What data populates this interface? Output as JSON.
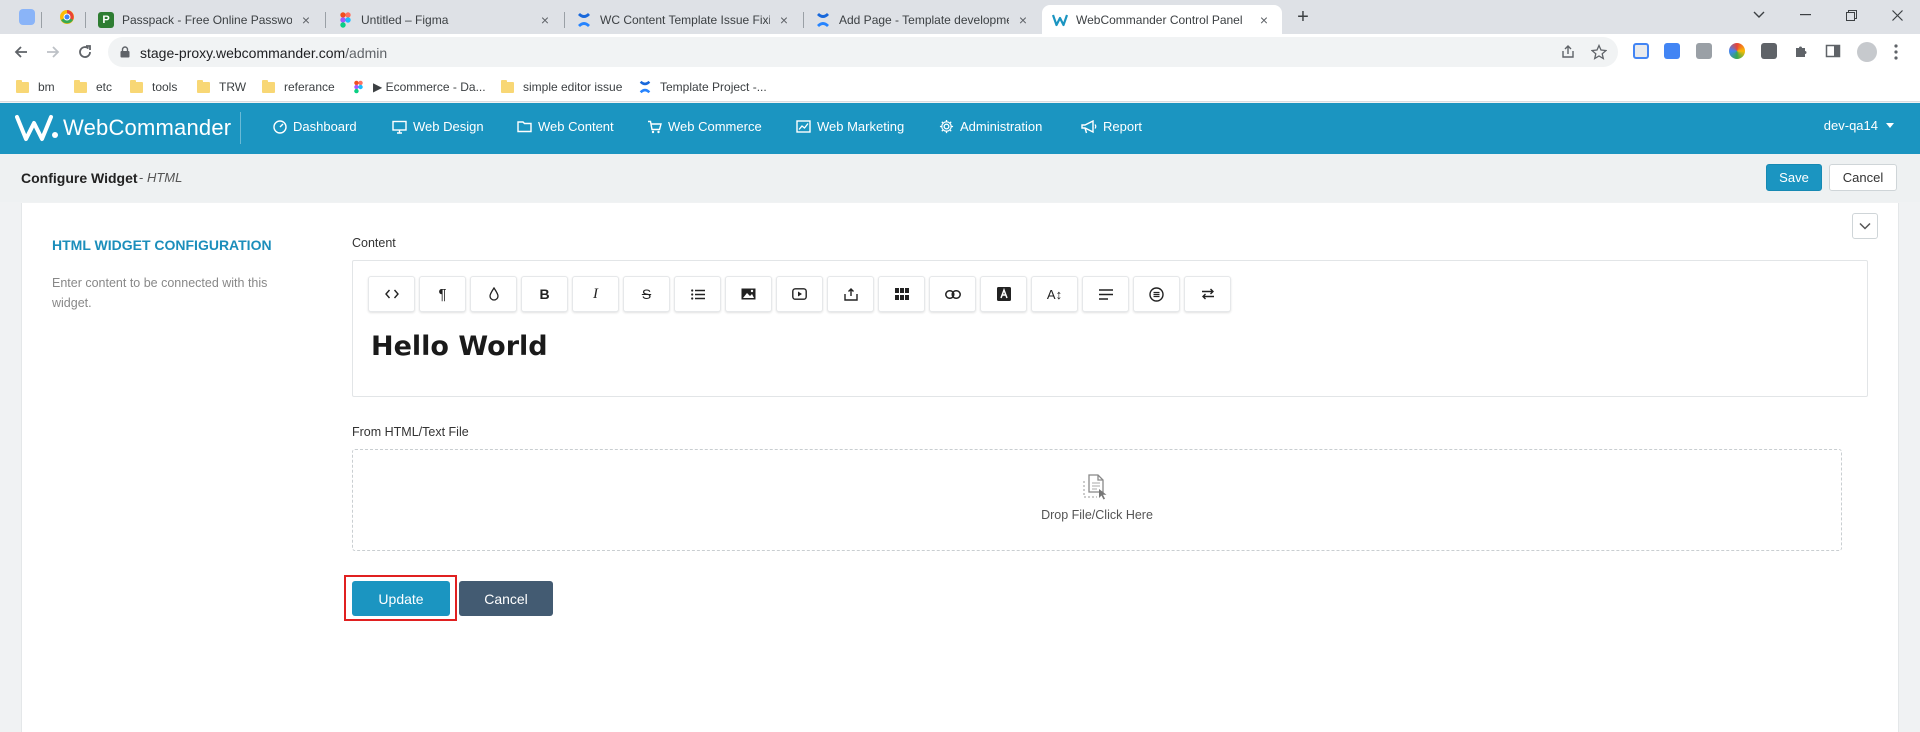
{
  "browser": {
    "tabs": [
      {
        "title": "Passpack - Free Online Password",
        "favicon": "passpack-icon"
      },
      {
        "title": "Untitled – Figma",
        "favicon": "figma-icon"
      },
      {
        "title": "WC Content Template Issue Fixing",
        "favicon": "confluence-icon"
      },
      {
        "title": "Add Page - Template development",
        "favicon": "confluence-icon"
      },
      {
        "title": "WebCommander Control Panel",
        "favicon": "webcommander-icon",
        "active": true
      }
    ],
    "url_host": "stage-proxy.webcommander.com",
    "url_path": "/admin",
    "bookmarks": [
      {
        "label": "bm",
        "icon": "folder-icon"
      },
      {
        "label": "etc",
        "icon": "folder-icon"
      },
      {
        "label": "tools",
        "icon": "folder-icon"
      },
      {
        "label": "TRW",
        "icon": "folder-icon"
      },
      {
        "label": "referance",
        "icon": "folder-icon"
      },
      {
        "label": "▶ Ecommerce - Da...",
        "icon": "figma-icon"
      },
      {
        "label": "simple editor issue",
        "icon": "folder-icon"
      },
      {
        "label": "Template Project -...",
        "icon": "confluence-icon"
      }
    ]
  },
  "app": {
    "logo_text": "WebCommander",
    "menu": [
      {
        "label": "Dashboard",
        "icon": "dashboard-icon"
      },
      {
        "label": "Web Design",
        "icon": "monitor-icon"
      },
      {
        "label": "Web Content",
        "icon": "folder-icon"
      },
      {
        "label": "Web Commerce",
        "icon": "cart-icon"
      },
      {
        "label": "Web Marketing",
        "icon": "chart-icon"
      },
      {
        "label": "Administration",
        "icon": "gear-icon"
      },
      {
        "label": "Report",
        "icon": "megaphone-icon"
      }
    ],
    "user": "dev-qa14",
    "colors": {
      "primary": "#1b95c1",
      "dark_button": "#435b72",
      "highlight": "#e02020"
    }
  },
  "page": {
    "title": "Configure Widget",
    "subtitle_prefix": "-",
    "subtitle": "HTML",
    "save_label": "Save",
    "cancel_label": "Cancel"
  },
  "widget": {
    "section_title": "HTML WIDGET CONFIGURATION",
    "section_desc": "Enter content to be connected with this widget.",
    "content_label": "Content",
    "toolbar": [
      {
        "icon": "code-view-icon",
        "glyph": "<>"
      },
      {
        "icon": "paragraph-icon",
        "glyph": "¶"
      },
      {
        "icon": "color-drop-icon",
        "glyph": ""
      },
      {
        "icon": "bold-icon",
        "glyph": "B"
      },
      {
        "icon": "italic-icon",
        "glyph": "I"
      },
      {
        "icon": "strikethrough-icon",
        "glyph": "S"
      },
      {
        "icon": "list-icon",
        "glyph": ""
      },
      {
        "icon": "image-icon",
        "glyph": ""
      },
      {
        "icon": "video-icon",
        "glyph": ""
      },
      {
        "icon": "upload-icon",
        "glyph": ""
      },
      {
        "icon": "table-icon",
        "glyph": ""
      },
      {
        "icon": "link-icon",
        "glyph": ""
      },
      {
        "icon": "font-icon",
        "glyph": "A"
      },
      {
        "icon": "font-size-icon",
        "glyph": "A↕"
      },
      {
        "icon": "align-icon",
        "glyph": ""
      },
      {
        "icon": "special-char-icon",
        "glyph": ""
      },
      {
        "icon": "direction-icon",
        "glyph": ""
      }
    ],
    "editor_content": "Hello World",
    "file_label": "From HTML/Text File",
    "dropzone_text": "Drop File/Click Here",
    "update_label": "Update",
    "cancel_label": "Cancel"
  }
}
